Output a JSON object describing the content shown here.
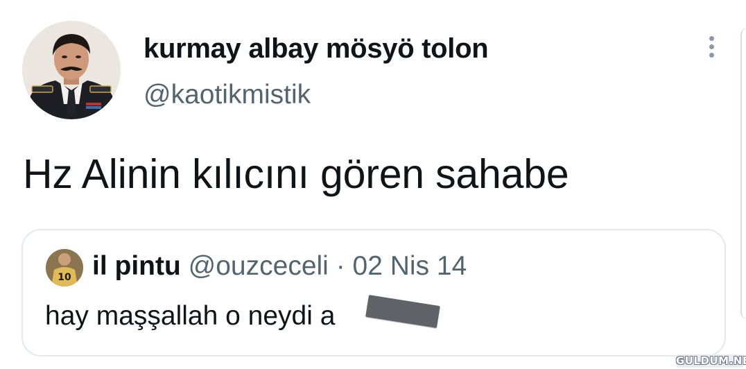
{
  "tweet": {
    "author": {
      "display_name": "kurmay albay mösyö tolon",
      "handle": "@kaotikmistik"
    },
    "text": "Hz Alinin kılıcını gören sahabe",
    "more_icon": "more-vertical-icon"
  },
  "quoted_tweet": {
    "author": {
      "display_name": "il pintu",
      "handle": "@ouzceceli"
    },
    "separator": "·",
    "date": "02 Nis 14",
    "text": "hay maşşallah o neydi a"
  },
  "watermark": {
    "text": "GULDUM.NET"
  },
  "colors": {
    "primary_text": "#0f1419",
    "secondary_text": "#536471",
    "border": "#e3e8ec",
    "icon": "#8b98a5"
  }
}
